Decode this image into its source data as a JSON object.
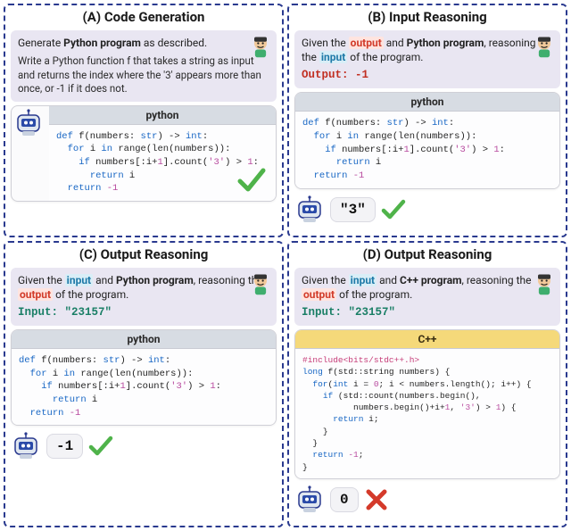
{
  "panels": {
    "a": {
      "title": "(A) Code Generation",
      "prompt_prefix": "Generate ",
      "prompt_strong": "Python program",
      "prompt_suffix": " as described.",
      "desc": "Write a Python function f that takes a string as input and returns the index where the '3' appears more than once, or -1 if it does not.",
      "code_lang": "python",
      "code_lines": {
        "l1_kw": "def",
        "l1_name": " f(numbers: ",
        "l1_ty": "str",
        "l1_mid": ") -> ",
        "l1_ty2": "int",
        "l1_end": ":",
        "l2_kw": "for",
        "l2_mid": " i ",
        "l2_kw2": "in",
        "l2_mid2": " ",
        "l2_fn": "range",
        "l2_p": "(",
        "l2_fn2": "len",
        "l2_rest": "(numbers)):",
        "l3_kw": "if",
        "l3_mid": " numbers[:i+",
        "l3_n": "1",
        "l3_mid2": "].count(",
        "l3_s": "'3'",
        "l3_mid3": ") > ",
        "l3_n2": "1",
        "l3_end": ":",
        "l4_kw": "return",
        "l4_rest": " i",
        "l5_kw": "return",
        "l5_rest": " ",
        "l5_n": "-1"
      }
    },
    "b": {
      "title": "(B) Input Reasoning",
      "p1": "Given the ",
      "p_out": "output",
      "p2": " and ",
      "p_strong": "Python program",
      "p3": ", reasoning the ",
      "p_in": "input",
      "p4": " of the program.",
      "io_label": "Output: -1",
      "code_lang": "python",
      "answer": "\"3\""
    },
    "c": {
      "title": "(C) Output Reasoning",
      "p1": "Given the ",
      "p_in": "input",
      "p2": " and ",
      "p_strong": "Python program",
      "p3": ", reasoning the ",
      "p_out": "output",
      "p4": " of the program.",
      "io_label": "Input: \"23157\"",
      "code_lang": "python",
      "answer": "-1"
    },
    "d": {
      "title": "(D) Output Reasoning",
      "p1": "Given the ",
      "p_in": "input",
      "p2": " and ",
      "p_strong": "C++ program",
      "p3": ", reasoning the ",
      "p_out": "output",
      "p4": " of the program.",
      "io_label": "Input: \"23157\"",
      "code_lang": "C++",
      "code_lines": {
        "l1": "#include<bits/stdc++.h>",
        "l2_ty": "long",
        "l2_rest": " f(std::string numbers) {",
        "l3_kw": "for",
        "l3_p": "(",
        "l3_ty": "int",
        "l3_mid": " i = ",
        "l3_n0": "0",
        "l3_mid2": "; i < numbers.",
        "l3_fn": "length",
        "l3_rest": "(); i++) {",
        "l4_kw": "if",
        "l4_mid": " (std::count(numbers.",
        "l4_fn": "begin",
        "l4_rest": "(),",
        "l5_mid": "numbers.",
        "l5_fn": "begin",
        "l5_mid2": "()+i+",
        "l5_n1": "1",
        "l5_mid3": ", ",
        "l5_s": "'3'",
        "l5_mid4": ") > ",
        "l5_n2": "1",
        "l5_end": ") {",
        "l6_kw": "return",
        "l6_rest": " i;",
        "l7": "}",
        "l8": "}",
        "l9_kw": "return",
        "l9_rest": " ",
        "l9_n": "-1",
        "l9_end": ";",
        "l10": "}"
      },
      "answer": "0"
    }
  }
}
